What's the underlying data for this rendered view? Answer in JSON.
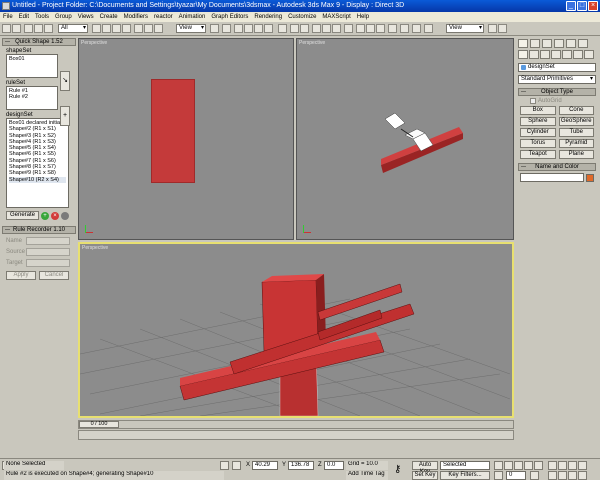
{
  "window": {
    "title": "Untitled    - Project Folder: C:\\Documents and Settings\\tyazar\\My Documents\\3dsmax    - Autodesk 3ds Max 9    - Display : Direct 3D",
    "min": "_",
    "max": "□",
    "close": "×"
  },
  "menu": [
    "File",
    "Edit",
    "Tools",
    "Group",
    "Views",
    "Create",
    "Modifiers",
    "reactor",
    "Animation",
    "Graph Editors",
    "Rendering",
    "Customize",
    "MAXScript",
    "Help"
  ],
  "toolbar": {
    "filter": "All",
    "view1": "View",
    "view2": "View"
  },
  "quick_shape": {
    "title": "Quick Shape 1.52",
    "shapeset_label": "shapeSet",
    "shapeset_items": [
      "Box01"
    ],
    "ruleset_label": "ruleSet",
    "ruleset_items": [
      "Rule #1",
      "Rule #2"
    ],
    "designset_label": "designSet",
    "designset_items": [
      "Box01 declared initial",
      "Shape#2 (R1 x S1)",
      "Shape#3 (R1 x S2)",
      "Shape#4 (R1 x S3)",
      "Shape#5 (R1 x S4)",
      "Shape#6 (R1 x S5)",
      "Shape#7 (R1 x S6)",
      "Shape#8 (R1 x S7)",
      "Shape#9 (R1 x S8)",
      "Shape#10 (R2 x S4)"
    ],
    "generate": "Generate"
  },
  "rule_recorder": {
    "title": "Rule Recorder 1.10",
    "name_label": "Name",
    "source_label": "Source",
    "target_label": "Target",
    "apply": "Apply",
    "cancel": "Cancel"
  },
  "viewports": {
    "top_left": "Perspective",
    "top_right": "Perspective",
    "bottom": "Perspective"
  },
  "command_panel": {
    "design_set": "designSet",
    "primitive_type": "Standard Primitives",
    "object_type_header": "Object Type",
    "autogrid": "AutoGrid",
    "buttons": [
      "Box",
      "Cone",
      "Sphere",
      "GeoSphere",
      "Cylinder",
      "Tube",
      "Torus",
      "Pyramid",
      "Teapot",
      "Plane"
    ],
    "name_color_header": "Name and Color"
  },
  "timeline": {
    "frame": "0 / 100"
  },
  "status": {
    "selection": "None Selected",
    "prompt": "Rule #2 is executed on Shape#4; generating Shape#10",
    "x_label": "X",
    "x_val": "40.29",
    "y_label": "Y",
    "y_val": "136.78",
    "z_label": "Z",
    "z_val": "0.0",
    "grid": "Grid = 10.0",
    "add_time_tag": "Add Time Tag",
    "auto_key": "Auto Key",
    "set_key": "Set Key",
    "selected": "Selected",
    "key_filters": "Key Filters...",
    "frame_num": "0"
  },
  "colors": {
    "object_red": "#c43a3a",
    "viewport_bg": "#8c8c8c",
    "active_border": "#e8e070",
    "color_swatch": "#e06a2a"
  }
}
